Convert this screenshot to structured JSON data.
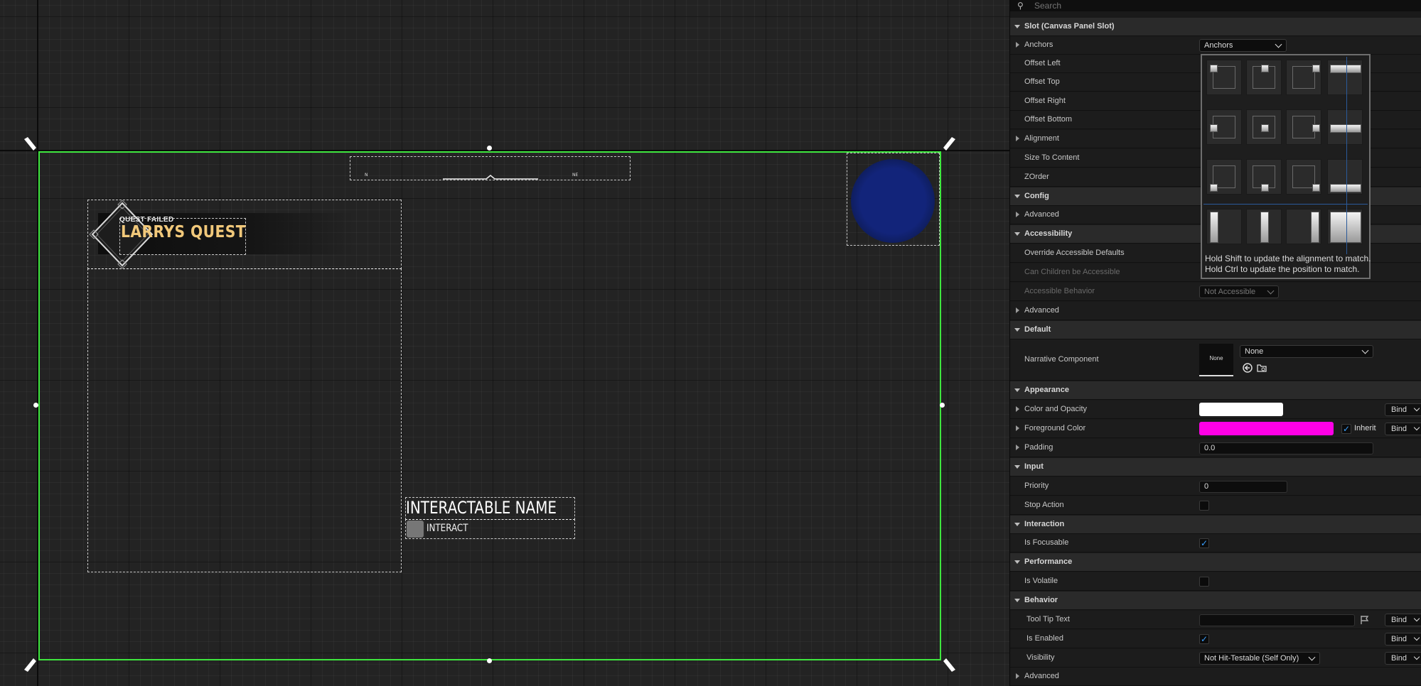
{
  "canvas": {
    "quest_status": "QUEST FAILED",
    "quest_title": "LARRYS QUEST",
    "compass_left": "N",
    "compass_right": "NE",
    "interactable_name": "INTERACTABLE NAME",
    "interact_label": "INTERACT"
  },
  "details": {
    "search_placeholder": "Search",
    "slot_section": "Slot (Canvas Panel Slot)",
    "anchors_label": "Anchors",
    "anchors_value": "Anchors",
    "offset_left": "Offset Left",
    "offset_top": "Offset Top",
    "offset_right": "Offset Right",
    "offset_bottom": "Offset Bottom",
    "alignment": "Alignment",
    "size_to_content": "Size To Content",
    "zorder": "ZOrder",
    "config_section": "Config",
    "config_advanced": "Advanced",
    "accessibility_section": "Accessibility",
    "override_accessible": "Override Accessible Defaults",
    "children_accessible": "Can Children be Accessible",
    "accessible_behavior": "Accessible Behavior",
    "accessible_behavior_value": "Not Accessible",
    "accessibility_advanced": "Advanced",
    "default_section": "Default",
    "narrative_component": "Narrative Component",
    "narrative_thumb": "None",
    "narrative_value": "None",
    "appearance_section": "Appearance",
    "color_opacity": "Color and Opacity",
    "foreground_color": "Foreground Color",
    "inherit_label": "Inherit",
    "padding": "Padding",
    "padding_value": "0.0",
    "input_section": "Input",
    "priority": "Priority",
    "priority_value": "0",
    "stop_action": "Stop Action",
    "interaction_section": "Interaction",
    "is_focusable": "Is Focusable",
    "performance_section": "Performance",
    "is_volatile": "Is Volatile",
    "behavior_section": "Behavior",
    "tooltip_text": "Tool Tip Text",
    "is_enabled": "Is Enabled",
    "visibility": "Visibility",
    "visibility_value": "Not Hit-Testable (Self Only)",
    "behavior_advanced": "Advanced",
    "bind_label": "Bind"
  },
  "anchors_popup": {
    "hint_line1": "Hold Shift to update the alignment to match.",
    "hint_line2": "Hold Ctrl to update the position to match."
  },
  "colors": {
    "color_opacity": "#ffffff",
    "foreground": "#ff00e6",
    "frame": "#3ee63e",
    "quest_title": "#f1c87a"
  },
  "checkboxes": {
    "inherit": true,
    "stop_action": false,
    "is_focusable": true,
    "is_volatile": false,
    "is_enabled": true
  }
}
